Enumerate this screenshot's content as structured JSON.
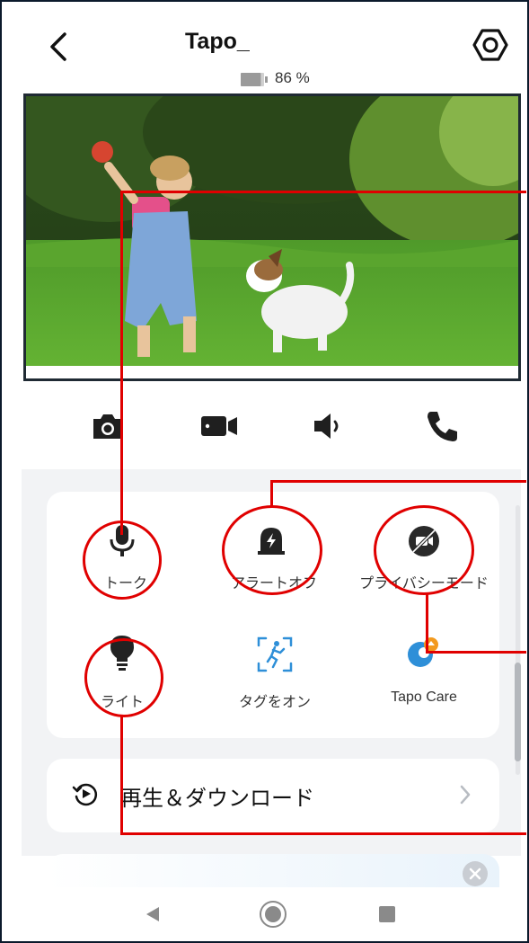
{
  "header": {
    "title": "Tapo_",
    "battery_percent_text": "86 %",
    "battery_level": 0.86
  },
  "icons": {
    "back": "chevron-left-icon",
    "settings": "hexagon-settings-icon",
    "snapshot": "camera-icon",
    "record": "video-camera-icon",
    "speaker": "speaker-icon",
    "call": "phone-icon"
  },
  "features": [
    {
      "label": "トーク",
      "icon": "microphone-icon"
    },
    {
      "label": "アラートオフ",
      "icon": "alarm-icon"
    },
    {
      "label": "プライバシーモード",
      "icon": "privacy-mode-icon"
    },
    {
      "label": "ライト",
      "icon": "light-bulb-icon"
    },
    {
      "label": "タグをオン",
      "icon": "motion-tag-icon"
    },
    {
      "label": "Tapo Care",
      "icon": "tapo-care-icon"
    }
  ],
  "playback": {
    "label": "再生＆ダウンロード",
    "icon": "playback-icon"
  },
  "colors": {
    "annotation": "#e00000",
    "accent_blue": "#2e8fd8",
    "icon_dark": "#222222",
    "panel_bg": "#f2f3f5"
  }
}
